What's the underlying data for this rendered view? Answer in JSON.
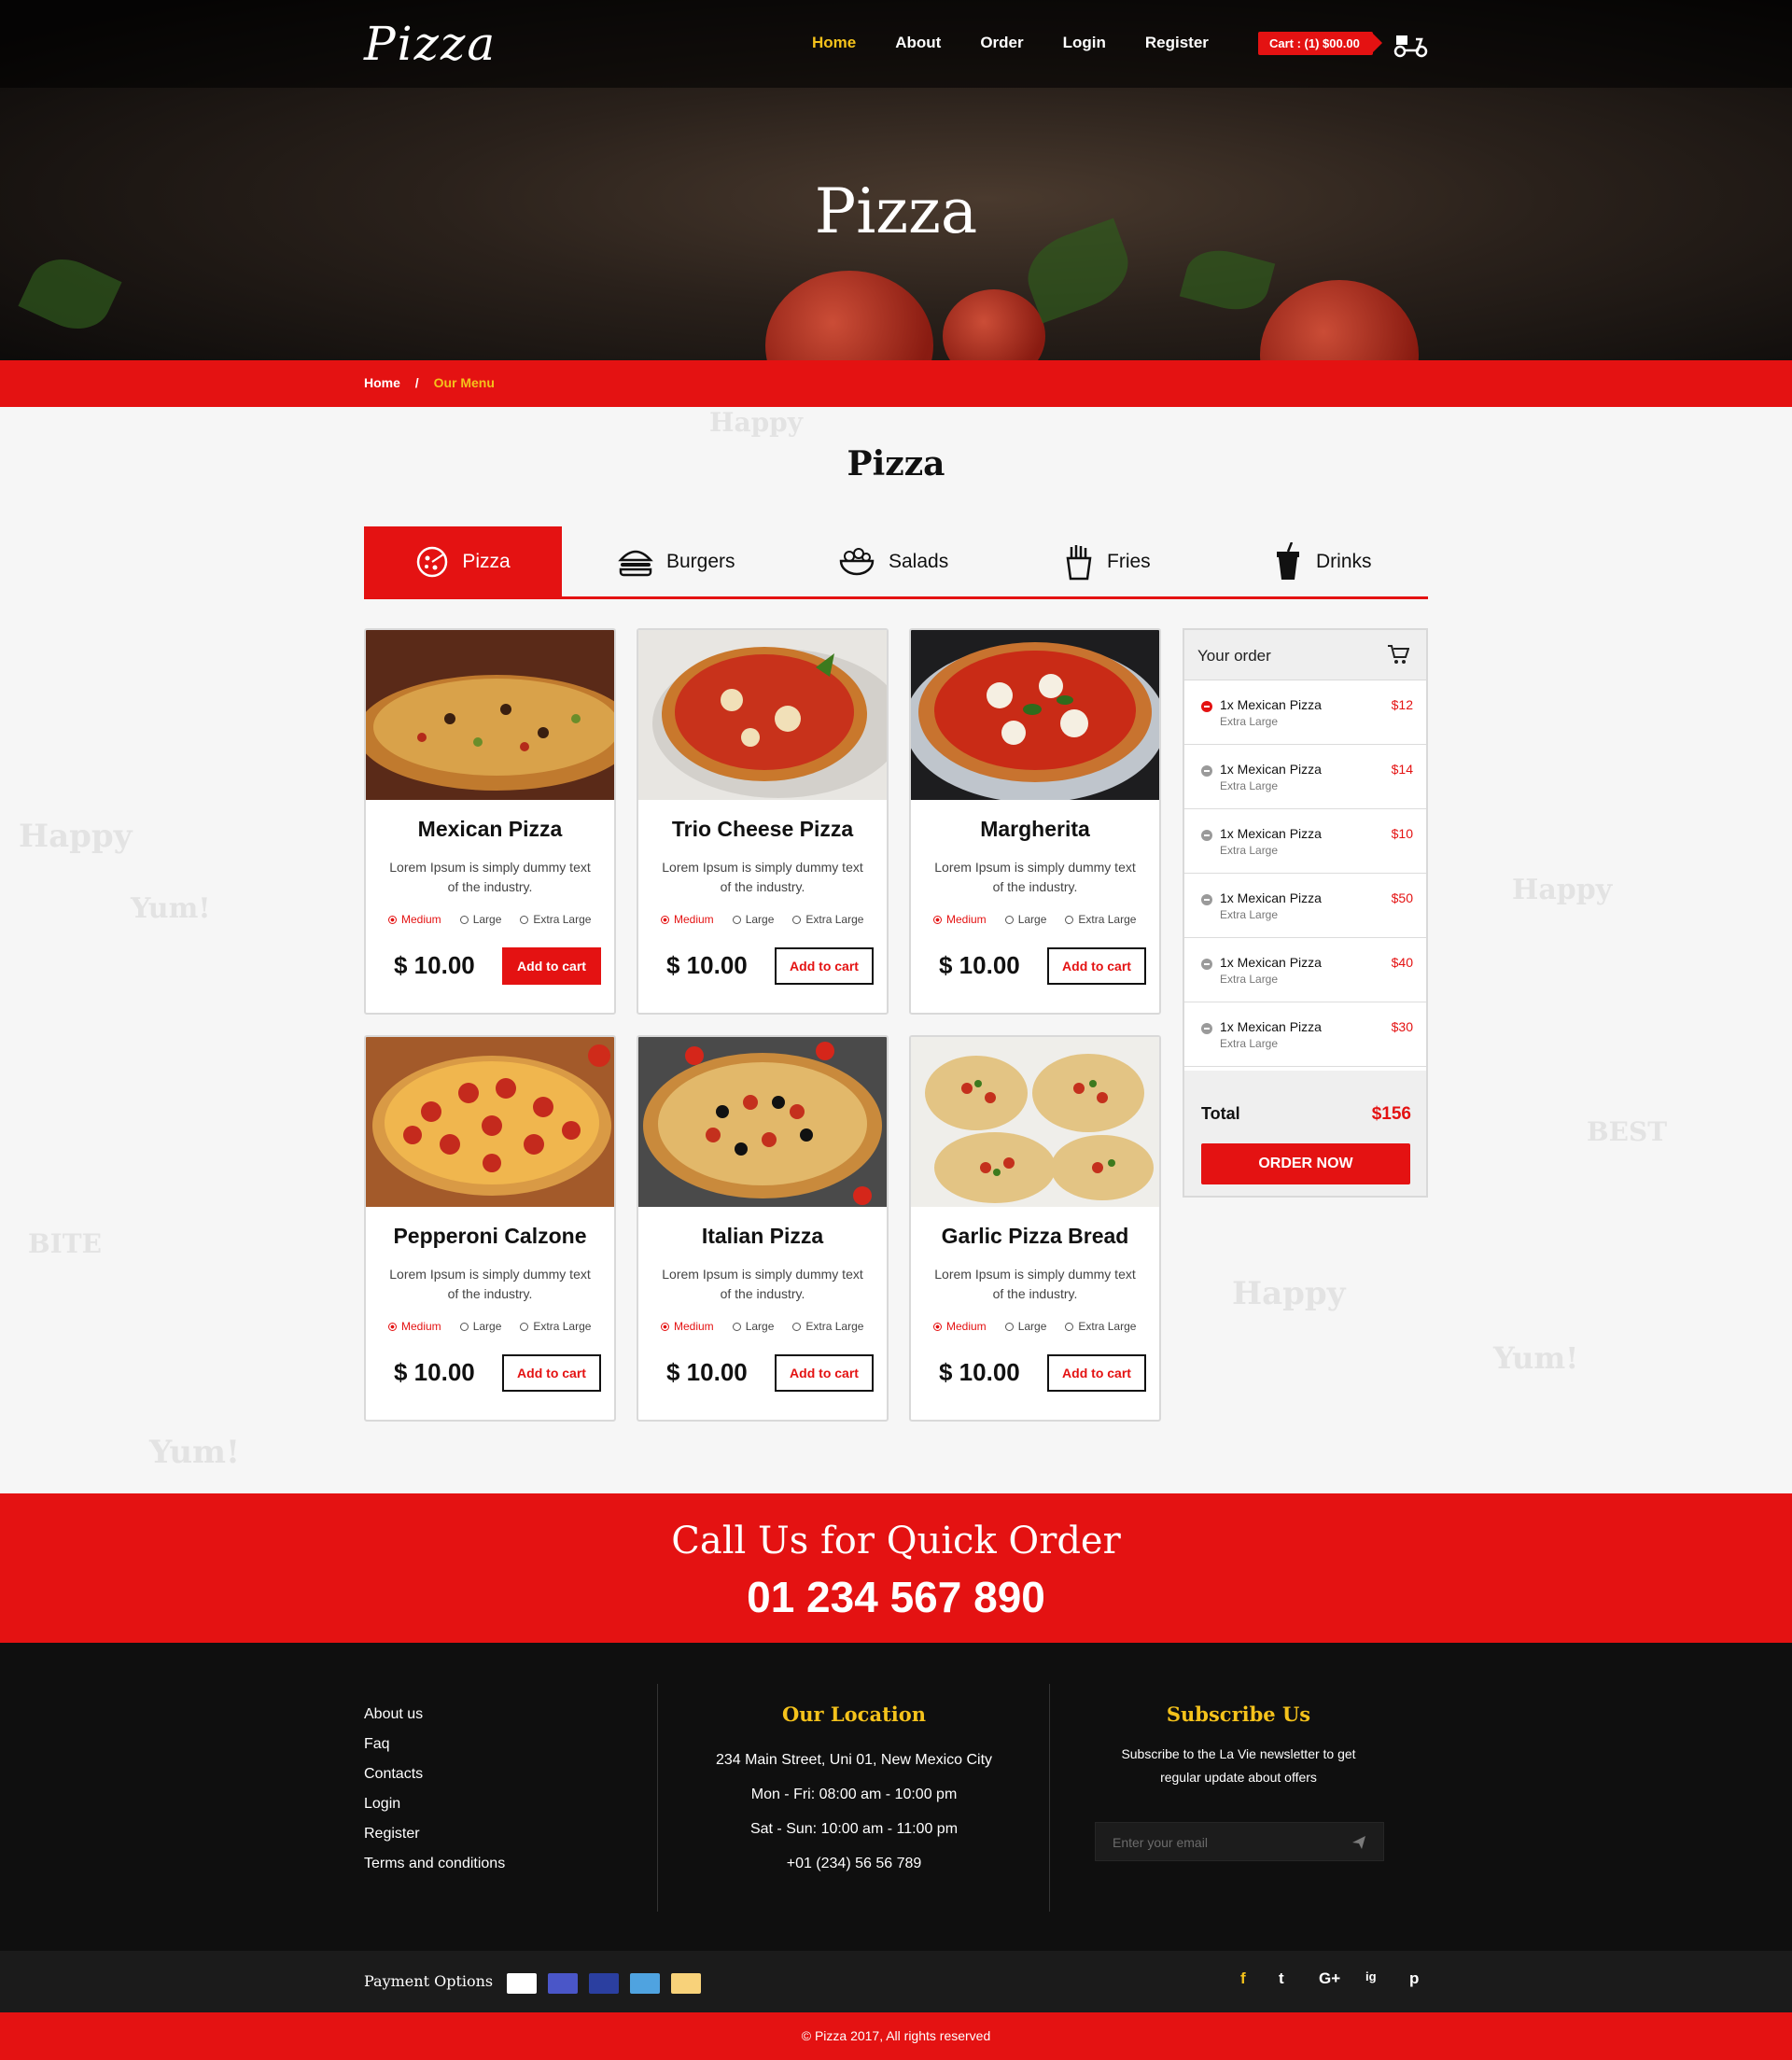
{
  "brand": {
    "logo": "Pizza"
  },
  "nav": {
    "items": [
      "Home",
      "About",
      "Order",
      "Login",
      "Register"
    ],
    "active": "Home",
    "cart": "Cart : (1) $00.00"
  },
  "hero": {
    "title": "Pizza"
  },
  "breadcrumb": {
    "home": "Home",
    "separator": "/",
    "current": "Our Menu"
  },
  "menu": {
    "title": "Pizza",
    "tabs": [
      {
        "label": "Pizza",
        "icon": "pizza-icon"
      },
      {
        "label": "Burgers",
        "icon": "burger-icon"
      },
      {
        "label": "Salads",
        "icon": "salad-bowl-icon"
      },
      {
        "label": "Fries",
        "icon": "fries-icon"
      },
      {
        "label": "Drinks",
        "icon": "drink-cup-icon"
      }
    ],
    "size_options": [
      "Medium",
      "Large",
      "Extra Large"
    ],
    "products": [
      {
        "name": "Mexican Pizza",
        "desc": "Lorem Ipsum is simply dummy text of the industry.",
        "price": "$ 10.00",
        "button": "Add to cart",
        "selected_size": "Medium"
      },
      {
        "name": "Trio Cheese Pizza",
        "desc": "Lorem Ipsum is simply dummy text of the industry.",
        "price": "$ 10.00",
        "button": "Add to cart",
        "selected_size": "Medium"
      },
      {
        "name": "Margherita",
        "desc": "Lorem Ipsum is simply dummy text of the industry.",
        "price": "$ 10.00",
        "button": "Add to cart",
        "selected_size": "Medium"
      },
      {
        "name": "Pepperoni Calzone",
        "desc": "Lorem Ipsum is simply dummy text of the industry.",
        "price": "$ 10.00",
        "button": "Add to cart",
        "selected_size": "Medium"
      },
      {
        "name": "Italian Pizza",
        "desc": "Lorem Ipsum is simply dummy text of the industry.",
        "price": "$ 10.00",
        "button": "Add to cart",
        "selected_size": "Medium"
      },
      {
        "name": "Garlic Pizza Bread",
        "desc": "Lorem Ipsum is simply dummy text of the industry.",
        "price": "$ 10.00",
        "button": "Add to cart",
        "selected_size": "Medium"
      }
    ]
  },
  "order": {
    "title": "Your order",
    "items": [
      {
        "name": "1x Mexican Pizza",
        "size": "Extra Large",
        "price": "$12"
      },
      {
        "name": "1x Mexican Pizza",
        "size": "Extra Large",
        "price": "$14"
      },
      {
        "name": "1x Mexican Pizza",
        "size": "Extra Large",
        "price": "$10"
      },
      {
        "name": "1x Mexican Pizza",
        "size": "Extra Large",
        "price": "$50"
      },
      {
        "name": "1x Mexican Pizza",
        "size": "Extra Large",
        "price": "$40"
      },
      {
        "name": "1x Mexican Pizza",
        "size": "Extra Large",
        "price": "$30"
      }
    ],
    "total_label": "Total",
    "total": "$156",
    "button": "ORDER NOW"
  },
  "call": {
    "title": "Call Us for Quick Order",
    "phone": "01 234 567 890"
  },
  "footer": {
    "links": [
      "About us",
      "Faq",
      "Contacts",
      "Login",
      "Register",
      "Terms and conditions"
    ],
    "location": {
      "title": "Our Location",
      "lines": [
        "234 Main Street, Uni 01, New Mexico City",
        "Mon - Fri: 08:00 am - 10:00 pm",
        "Sat - Sun: 10:00 am - 11:00 pm",
        "+01 (234) 56 56 789"
      ]
    },
    "subscribe": {
      "title": "Subscribe Us",
      "text1": "Subscribe to the La Vie newsletter to get",
      "text2": "regular update about offers",
      "placeholder": "Enter your email"
    },
    "payment_label": "Payment Options",
    "payment_cards": [
      "PayPal",
      "Mastercard",
      "Maestro",
      "Stripe",
      "Bitcoin"
    ],
    "social": [
      "f",
      "t",
      "G+",
      "ig",
      "p"
    ],
    "copyright": "© Pizza 2017, All rights reserved"
  },
  "colors": {
    "accent": "#e41212",
    "highlight": "#f4c21b",
    "dark": "#0f0f0f"
  }
}
